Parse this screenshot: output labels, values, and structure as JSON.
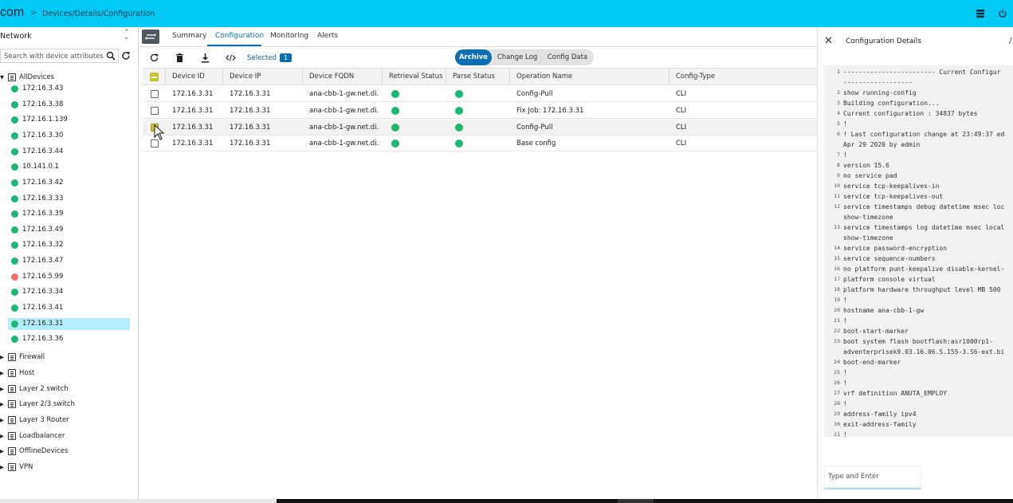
{
  "header": {
    "brand": "com",
    "breadcrumb_sep": ">",
    "breadcrumb": "Devices/Details/Configuration"
  },
  "left_panel": {
    "title": "Network",
    "search_placeholder": "Search with device attributes",
    "root": "AllDevices",
    "devices": [
      {
        "ip": "172.16.3.43",
        "status": "green"
      },
      {
        "ip": "172.16.3.38",
        "status": "green"
      },
      {
        "ip": "172.16.1.139",
        "status": "green"
      },
      {
        "ip": "172.16.3.30",
        "status": "green"
      },
      {
        "ip": "172.16.3.44",
        "status": "green"
      },
      {
        "ip": "10.141.0.1",
        "status": "green"
      },
      {
        "ip": "172.16.3.42",
        "status": "green"
      },
      {
        "ip": "172.16.3.33",
        "status": "green"
      },
      {
        "ip": "172.16.3.39",
        "status": "green"
      },
      {
        "ip": "172.16.3.49",
        "status": "green"
      },
      {
        "ip": "172.16.3.32",
        "status": "green"
      },
      {
        "ip": "172.16.3.47",
        "status": "green"
      },
      {
        "ip": "172.16.5.99",
        "status": "red"
      },
      {
        "ip": "172.16.3.34",
        "status": "green"
      },
      {
        "ip": "172.16.3.41",
        "status": "green"
      },
      {
        "ip": "172.16.3.31",
        "status": "green",
        "selected": true
      },
      {
        "ip": "172.16.3.36",
        "status": "green"
      }
    ],
    "groups": [
      "Firewall",
      "Host",
      "Layer 2 switch",
      "Layer 2/3 switch",
      "Layer 3 Router",
      "Loadbalancer",
      "OfflineDevices",
      "VPN"
    ]
  },
  "tabs": [
    "Summary",
    "Configuration",
    "Monitoring",
    "Alerts"
  ],
  "active_tab": "Configuration",
  "toolbar": {
    "selected_label": "Selected",
    "selected_count": "1",
    "segments": [
      "Archive",
      "Change Log",
      "Config Data"
    ],
    "active_segment": "Archive"
  },
  "grid": {
    "columns": [
      "Device ID",
      "Device IP",
      "Device FQDN",
      "Retrieval Status",
      "Parse Status",
      "Operation Name",
      "Config-Type"
    ],
    "rows": [
      {
        "device_id": "172.16.3.31",
        "device_ip": "172.16.3.31",
        "fqdn": "ana-cbb-1-gw.net.di...",
        "operation": "Config-Pull",
        "config_type": "CLI",
        "checked": false
      },
      {
        "device_id": "172.16.3.31",
        "device_ip": "172.16.3.31",
        "fqdn": "ana-cbb-1-gw.net.di...",
        "operation": "Fix Job: 172.16.3.31",
        "config_type": "CLI",
        "checked": false
      },
      {
        "device_id": "172.16.3.31",
        "device_ip": "172.16.3.31",
        "fqdn": "ana-cbb-1-gw.net.di...",
        "operation": "Config-Pull",
        "config_type": "CLI",
        "checked": true
      },
      {
        "device_id": "172.16.3.31",
        "device_ip": "172.16.3.31",
        "fqdn": "ana-cbb-1-gw.net.di...",
        "operation": "Base config",
        "config_type": "CLI",
        "checked": false
      }
    ]
  },
  "details": {
    "title": "Configuration Details",
    "input_placeholder": "Type and Enter",
    "lines": [
      {
        "n": "1",
        "t": "------------------------ Current Configur"
      },
      {
        "n": "",
        "t": "------------------"
      },
      {
        "n": "2",
        "t": "show running-config"
      },
      {
        "n": "3",
        "t": "Building configuration..."
      },
      {
        "n": "4",
        "t": "Current configuration : 34837 bytes"
      },
      {
        "n": "5",
        "t": "!"
      },
      {
        "n": "6",
        "t": "! Last configuration change at 23:49:37 ed"
      },
      {
        "n": "",
        "t": "Apr 29 2020 by admin"
      },
      {
        "n": "7",
        "t": "!"
      },
      {
        "n": "8",
        "t": "version 15.6"
      },
      {
        "n": "9",
        "t": "no service pad"
      },
      {
        "n": "10",
        "t": "service tcp-keepalives-in"
      },
      {
        "n": "11",
        "t": "service tcp-keepalives-out"
      },
      {
        "n": "12",
        "t": "service timestamps debug datetime msec loc"
      },
      {
        "n": "",
        "t": "show-timezone"
      },
      {
        "n": "13",
        "t": "service timestamps log datetime msec local"
      },
      {
        "n": "",
        "t": "show-timezone"
      },
      {
        "n": "14",
        "t": "service password-encryption"
      },
      {
        "n": "15",
        "t": "service sequence-numbers"
      },
      {
        "n": "16",
        "t": "no platform punt-keepalive disable-kernel-"
      },
      {
        "n": "17",
        "t": "platform console virtual"
      },
      {
        "n": "18",
        "t": "platform hardware throughput level MB 500"
      },
      {
        "n": "19",
        "t": "!"
      },
      {
        "n": "20",
        "t": "hostname ana-cbb-1-gw"
      },
      {
        "n": "21",
        "t": "!"
      },
      {
        "n": "22",
        "t": "boot-start-marker"
      },
      {
        "n": "23",
        "t": "boot system flash bootflash:asr1000rp1-"
      },
      {
        "n": "",
        "t": "adventerprisek9.03.16.06.S.155-3.S6-ext.bi"
      },
      {
        "n": "24",
        "t": "boot-end-marker"
      },
      {
        "n": "25",
        "t": "!"
      },
      {
        "n": "26",
        "t": "!"
      },
      {
        "n": "27",
        "t": "vrf definition ANUTA_EMPLOY"
      },
      {
        "n": "28",
        "t": "!"
      },
      {
        "n": "29",
        "t": "address-family ipv4"
      },
      {
        "n": "30",
        "t": "exit-address-family"
      },
      {
        "n": "31",
        "t": "!"
      }
    ]
  }
}
